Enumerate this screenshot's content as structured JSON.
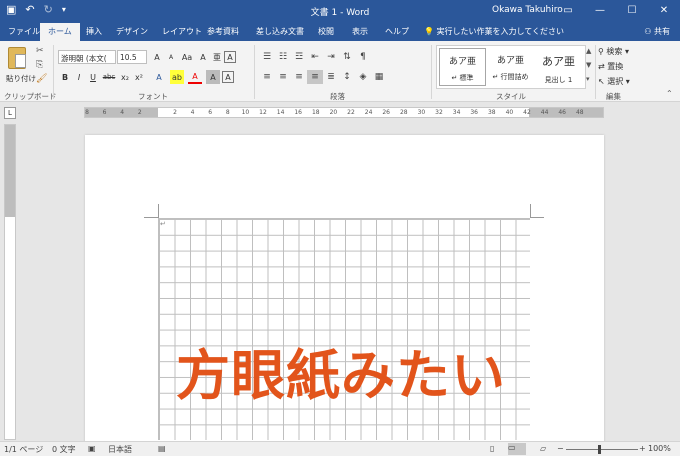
{
  "titlebar": {
    "save_icon": "save-icon",
    "undo_icon": "undo-icon",
    "redo_icon": "redo-icon",
    "customize_icon": "customize-quick-access-icon",
    "title": "文書 1  -  Word",
    "user": "Okawa Takuhiro",
    "ribbon_display_icon": "ribbon-display-options-icon",
    "minimize_icon": "minimize-icon",
    "maximize_icon": "maximize-icon",
    "close_icon": "close-icon",
    "bg_color": "#2b579a"
  },
  "tabs": {
    "file": "ファイル",
    "home": "ホーム",
    "insert": "挿入",
    "design": "デザイン",
    "layout": "レイアウト",
    "references": "参考資料",
    "mailings": "差し込み文書",
    "review": "校閲",
    "view": "表示",
    "help": "ヘルプ",
    "tell_me": "実行したい作業を入力してください",
    "share": "共有"
  },
  "ribbon": {
    "clipboard": {
      "paste": "貼り付け",
      "label": "クリップボード"
    },
    "font": {
      "name": "游明朝 (本文(",
      "size": "10.5",
      "grow": "A",
      "shrink": "A",
      "case": "Aa",
      "clear": "A",
      "phonetic": "亜",
      "enclose": "A",
      "bold": "B",
      "italic": "I",
      "underline": "U",
      "strike": "abc",
      "subscript": "x₂",
      "superscript": "x²",
      "effects": "A",
      "highlight": "ab",
      "color": "A",
      "char_shading": "A",
      "char_border": "A",
      "label": "フォント"
    },
    "paragraph": {
      "label": "段落"
    },
    "styles": {
      "label": "スタイル",
      "items": [
        {
          "preview": "あア亜",
          "name": "↵ 標準"
        },
        {
          "preview": "あア亜",
          "name": "↵ 行間詰め"
        },
        {
          "preview": "あア亜",
          "name": "見出し 1"
        }
      ]
    },
    "editing": {
      "find": "検索",
      "replace": "置換",
      "select": "選択",
      "label": "編集"
    }
  },
  "ruler": {
    "corner": "L",
    "numbers": [
      "8",
      "6",
      "4",
      "2",
      "",
      "2",
      "4",
      "6",
      "8",
      "10",
      "12",
      "14",
      "16",
      "18",
      "20",
      "22",
      "24",
      "26",
      "28",
      "30",
      "32",
      "34",
      "36",
      "38",
      "40",
      "42",
      "44",
      "46",
      "48"
    ]
  },
  "document": {
    "paragraph_mark": "↵",
    "headline": "方眼紙みたい",
    "headline_color": "#e2541b"
  },
  "statusbar": {
    "page": "1/1 ページ",
    "words": "0 文字",
    "language": "日本語",
    "zoom": "100%"
  }
}
